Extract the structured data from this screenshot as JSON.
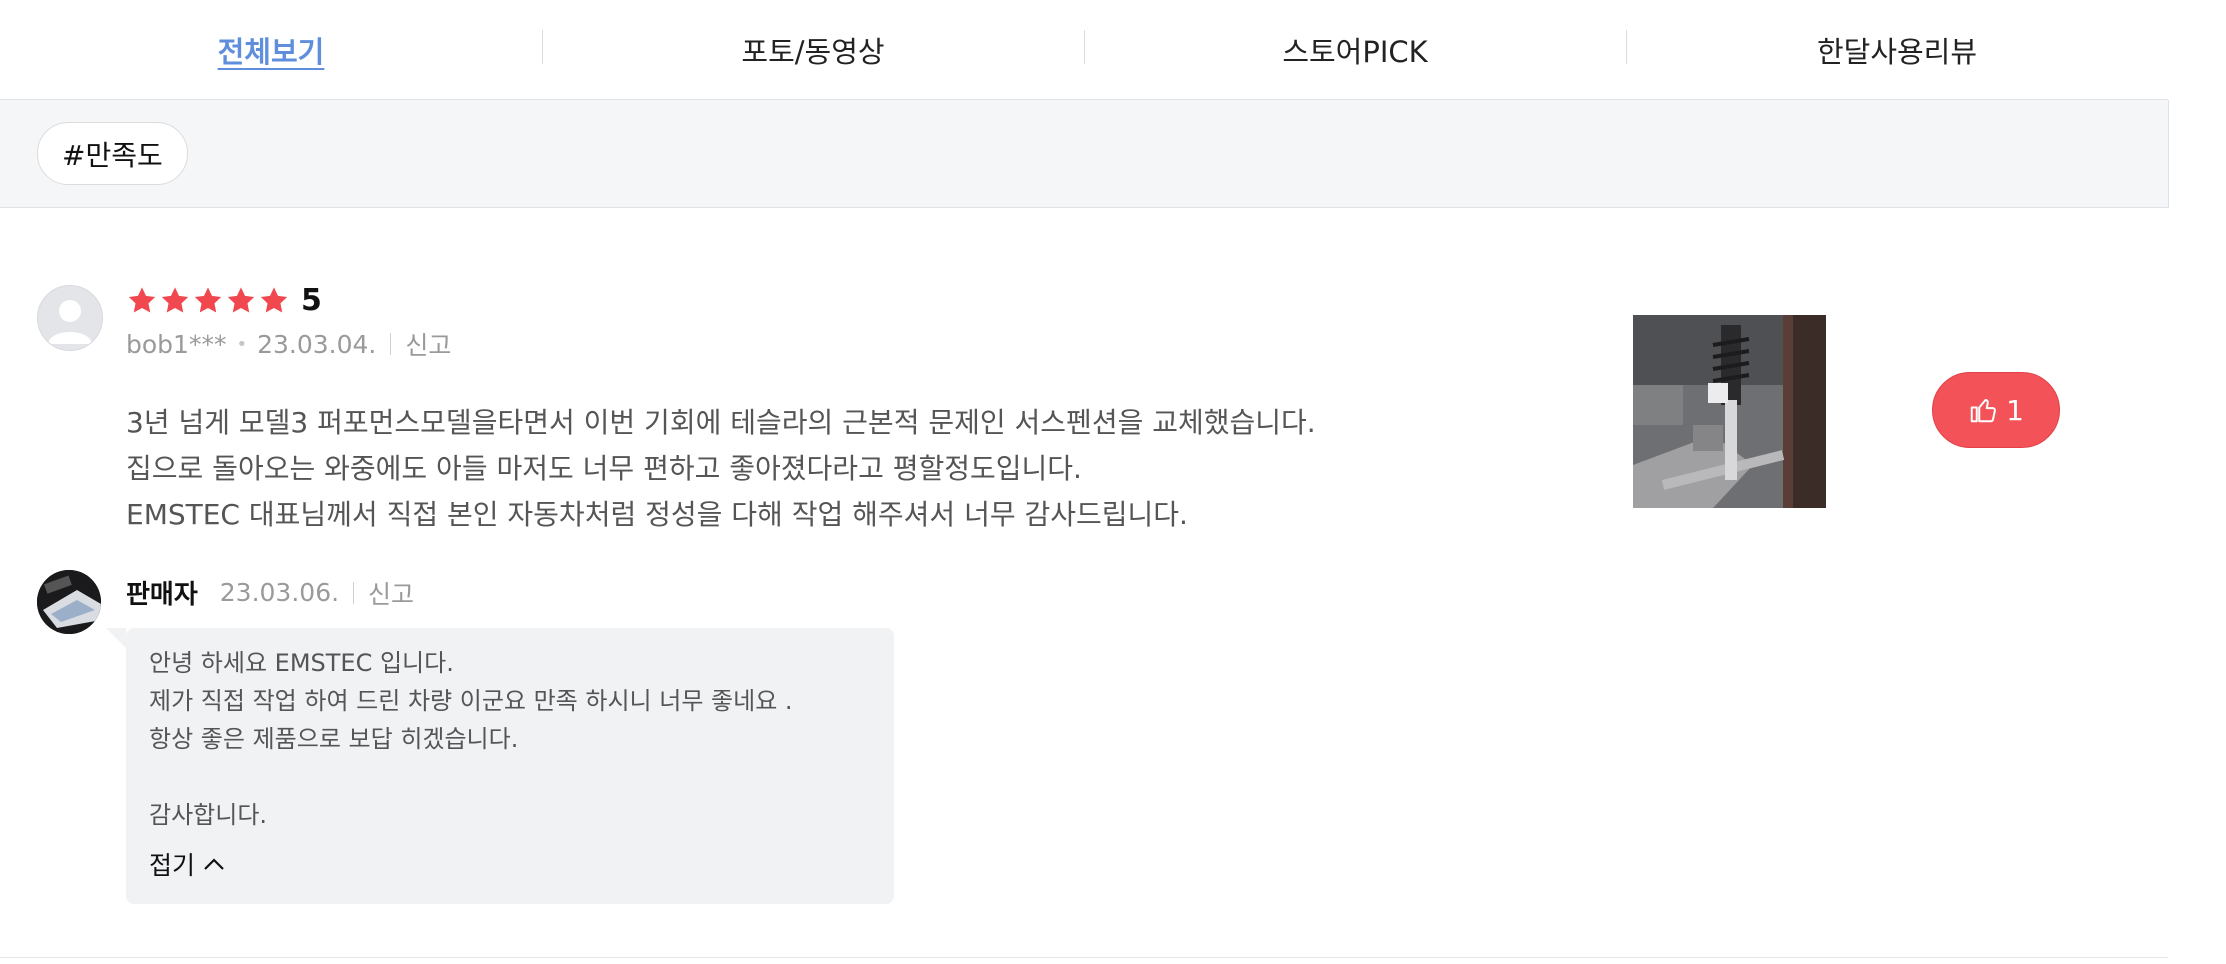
{
  "tabs": [
    {
      "label": "전체보기"
    },
    {
      "label": "포토/동영상"
    },
    {
      "label": "스토어PICK"
    },
    {
      "label": "한달사용리뷰"
    }
  ],
  "filter": {
    "chip_label": "#만족도"
  },
  "review": {
    "rating_value": 5,
    "rating_text": "5",
    "author": "bob1***",
    "date": "23.03.04.",
    "report_label": "신고",
    "lines": [
      "3년 넘게 모델3 퍼포먼스모델을타면서 이번 기회에 테슬라의 근본적 문제인 서스펜션을 교체했습니다.",
      "집으로 돌아오는 와중에도 아들 마저도 너무 편하고 좋아졌다라고 평할정도입니다.",
      "EMSTEC 대표님께서 직접 본인 자동차처럼 정성을 다해 작업 해주셔서 너무 감사드립니다."
    ],
    "like_count": "1",
    "colors": {
      "star": "#f1484f",
      "like_bg": "#f25258"
    }
  },
  "seller": {
    "name": "판매자",
    "date": "23.03.06.",
    "report_label": "신고",
    "lines": [
      "안녕 하세요 EMSTEC 입니다.",
      "제가 직접 작업 하여 드린 차량 이군요 만족 하시니 너무 좋네요 .",
      "항상 좋은 제품으로 보답 히겠습니다.",
      "",
      "감사합니다."
    ],
    "fold_label": "접기"
  }
}
